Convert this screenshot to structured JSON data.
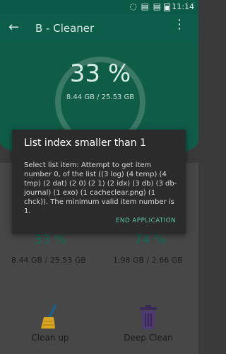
{
  "status_bar": {
    "time": "11:14",
    "icons": "◌ ▤ ▤"
  },
  "app_bar": {
    "title": "B - Cleaner"
  },
  "main": {
    "ring_percent": "33 %",
    "ring_sub": "8.44 GB / 25.53 GB",
    "stats": [
      {
        "percent": "33 %",
        "usage": "8.44 GB / 25.53 GB"
      },
      {
        "percent": "74 %",
        "usage": "1.98 GB / 2.66 GB"
      }
    ],
    "actions": [
      {
        "label": "Clean up"
      },
      {
        "label": "Deep Clean"
      }
    ]
  },
  "dialog": {
    "title": "List index smaller than 1",
    "message": "Select list item: Attempt to get item number 0, of the list ((3 log) (4 temp) (4 tmp) (2 dat) (2 0) (2 1) (2 idx) (3 db) (3 db-journal) (1 exo) (1 cacheclear.png) (1 chck)).  The minimum valid item number is 1.",
    "button": "END APPLICATION"
  },
  "colors": {
    "accent": "#5fbfa6",
    "header": "#0c5d49"
  }
}
